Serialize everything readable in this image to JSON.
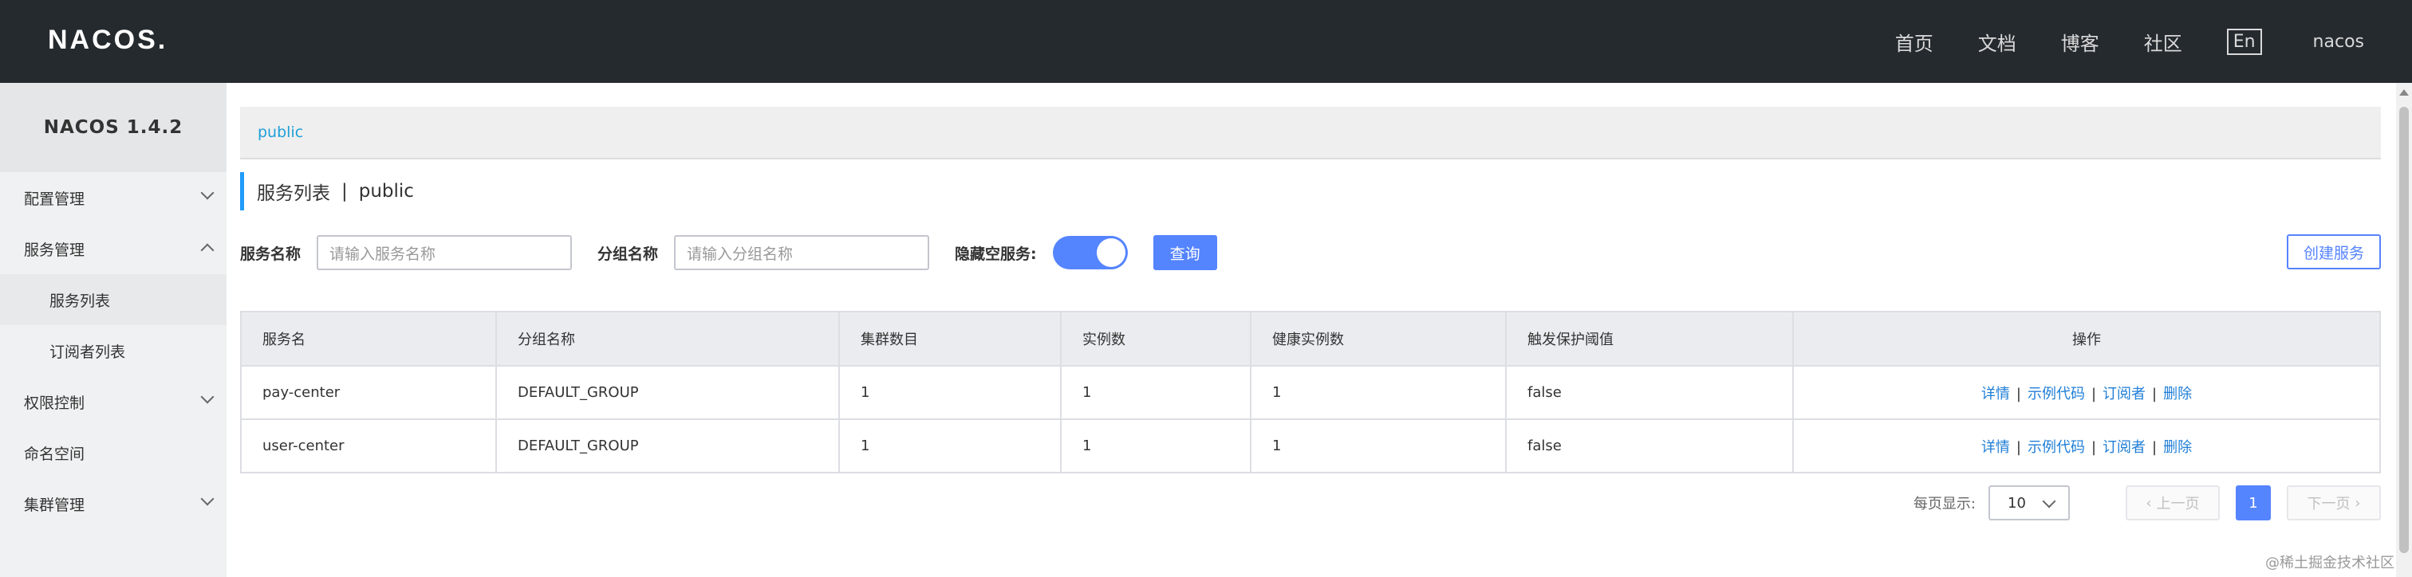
{
  "header": {
    "logo": "NACOS.",
    "nav": [
      "首页",
      "文档",
      "博客",
      "社区"
    ],
    "lang_button": "En",
    "user": "nacos"
  },
  "sidebar": {
    "title": "NACOS 1.4.2",
    "items": [
      {
        "label": "配置管理",
        "expand": "collapsed"
      },
      {
        "label": "服务管理",
        "expand": "expanded"
      },
      {
        "label": "服务列表",
        "sub": true,
        "active": true
      },
      {
        "label": "订阅者列表",
        "sub": true
      },
      {
        "label": "权限控制",
        "expand": "collapsed"
      },
      {
        "label": "命名空间"
      },
      {
        "label": "集群管理",
        "expand": "collapsed"
      }
    ]
  },
  "main": {
    "namespace": "public",
    "title": "服务列表",
    "title_sep": "|",
    "title_ns": "public",
    "filters": {
      "service_name_label": "服务名称",
      "service_name_placeholder": "请输入服务名称",
      "group_name_label": "分组名称",
      "group_name_placeholder": "请输入分组名称",
      "hide_empty_label": "隐藏空服务:",
      "hide_empty_on": true,
      "query_button": "查询",
      "create_button": "创建服务"
    },
    "table": {
      "columns": [
        "服务名",
        "分组名称",
        "集群数目",
        "实例数",
        "健康实例数",
        "触发保护阈值",
        "操作"
      ],
      "rows": [
        {
          "name": "pay-center",
          "group": "DEFAULT_GROUP",
          "clusters": "1",
          "instances": "1",
          "healthy": "1",
          "threshold": "false"
        },
        {
          "name": "user-center",
          "group": "DEFAULT_GROUP",
          "clusters": "1",
          "instances": "1",
          "healthy": "1",
          "threshold": "false"
        }
      ],
      "actions": [
        "详情",
        "示例代码",
        "订阅者",
        "删除"
      ]
    },
    "pagination": {
      "page_size_label": "每页显示:",
      "page_size": "10",
      "prev": "上一页",
      "current": "1",
      "next": "下一页"
    }
  },
  "watermark": "@稀土掘金技术社区",
  "colors": {
    "header_bg": "#252a2f",
    "primary": "#5584ff",
    "link": "#1f7ed6",
    "namespace_link": "#1fa0d8"
  }
}
